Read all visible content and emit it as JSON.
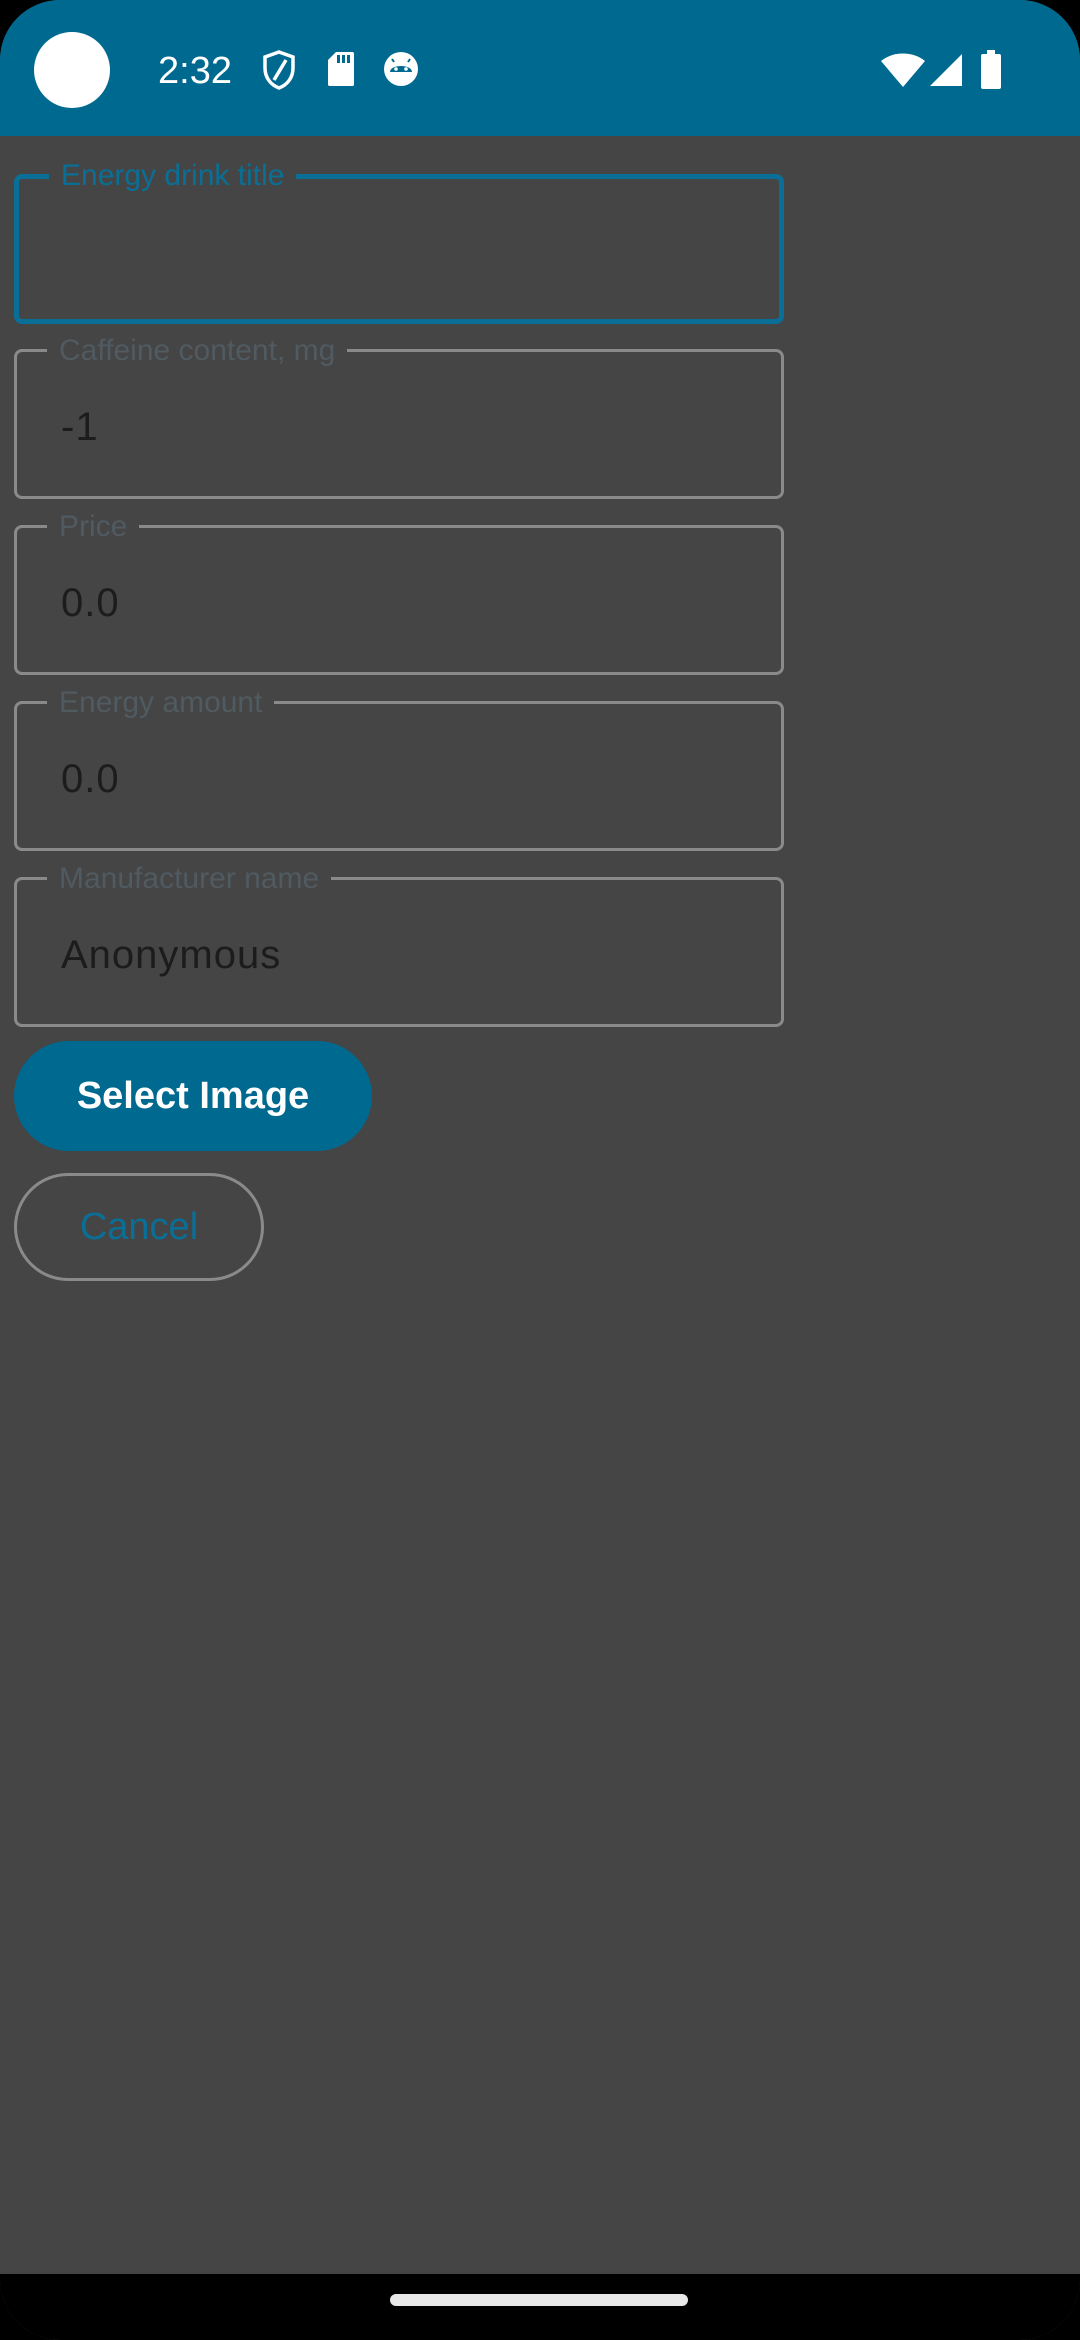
{
  "status_bar": {
    "time": "2:32",
    "left_icons": [
      "camera-dot",
      "shield-icon",
      "sd-card-icon",
      "android-face-icon"
    ],
    "right_icons": [
      "wifi-icon",
      "cell-signal-icon",
      "battery-icon"
    ],
    "background_color": "#00698f"
  },
  "form": {
    "fields": [
      {
        "label": "Energy drink title",
        "value": "",
        "focused": true
      },
      {
        "label": "Caffeine content, mg",
        "value": "-1",
        "focused": false
      },
      {
        "label": "Price",
        "value": "0.0",
        "focused": false
      },
      {
        "label": "Energy amount",
        "value": "0.0",
        "focused": false
      },
      {
        "label": "Manufacturer name",
        "value": "Anonymous",
        "focused": false
      }
    ]
  },
  "buttons": {
    "select_image": "Select Image",
    "cancel": "Cancel"
  },
  "colors": {
    "accent": "#00698f",
    "background": "#454545",
    "outline": "#8a8a8a",
    "value_text": "#1c1c1c"
  }
}
